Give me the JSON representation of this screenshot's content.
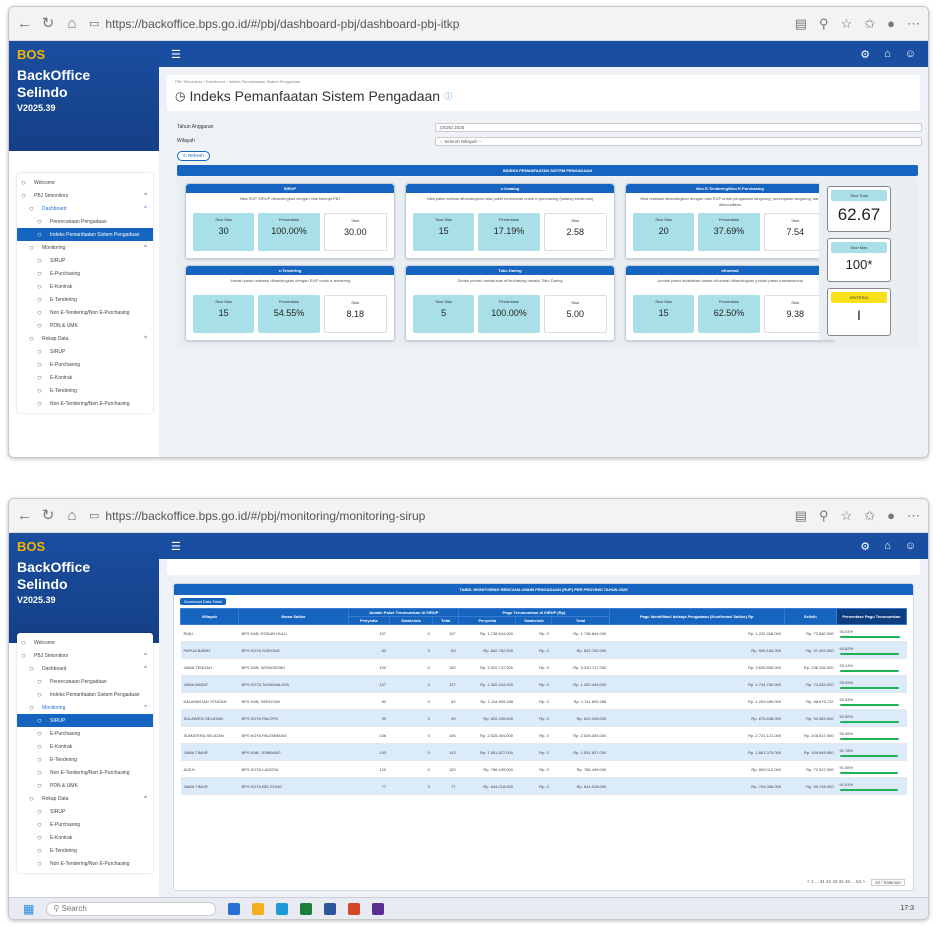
{
  "shot1": {
    "url": "https://backoffice.bps.go.id/#/pbj/dashboard-pbj/dashboard-pbj-itkp",
    "app": {
      "logo": "BOS",
      "name_line1": "BackOffice",
      "name_line2": "Selindo",
      "version": "V2025.39"
    },
    "menu": [
      {
        "label": "Welcome",
        "level": 0
      },
      {
        "label": "PBJ Simonitors",
        "level": 0,
        "caret": "^"
      },
      {
        "label": "Dashboard",
        "level": 1,
        "caret": "^",
        "hi": true
      },
      {
        "label": "Perencanaan Pengadaan",
        "level": 2
      },
      {
        "label": "Indeks Pemanfaatan Sistem Pengadaan",
        "level": 2,
        "selected": true
      },
      {
        "label": "Monitoring",
        "level": 1,
        "caret": "^"
      },
      {
        "label": "SIRUP",
        "level": 2
      },
      {
        "label": "E-Purchasing",
        "level": 2
      },
      {
        "label": "E-Kontrak",
        "level": 2
      },
      {
        "label": "E-Tendering",
        "level": 2
      },
      {
        "label": "Non E-Tendering/Non E-Purchasing",
        "level": 2
      },
      {
        "label": "PDN & UMK",
        "level": 2
      },
      {
        "label": "Rekap Data",
        "level": 1,
        "caret": "^"
      },
      {
        "label": "SIRUP",
        "level": 2
      },
      {
        "label": "E-Purchasing",
        "level": 2
      },
      {
        "label": "E-Kontrak",
        "level": 2
      },
      {
        "label": "E-Tendering",
        "level": 2
      },
      {
        "label": "Non E-Tendering/Non E-Purchasing",
        "level": 2
      }
    ],
    "breadcrumb": "PBJ Simonitors / Dashboard / Indeks Pemanfaatan Sistem Pengadaan",
    "page_title": "Indeks Pemanfaatan Sistem Pengadaan",
    "filter_tahun_label": "Tahun Anggaran",
    "filter_tahun_value": "(2025) 2025",
    "filter_wilayah_label": "Wilayah",
    "filter_wilayah_value": "-- Seluruh Wilayah --",
    "refresh_label": "Refresh",
    "banner": "INDEKS PEMANFAATAN SISTEM PENGADAAN",
    "panels": [
      {
        "title": "SIRUP",
        "desc": "Nilai RUP SIRUP dibandingkan dengan nilai belanja PBJ",
        "k1": "Skor Max",
        "v1": "30",
        "k2": "Persentase",
        "v2": "100.00%",
        "k3": "Skor",
        "v3": "30.00"
      },
      {
        "title": "e-Katalog",
        "desc": "Nilai paket selesai dibandingkan nilai paket berkontrak untuk e-purchasing (katalog elektronik)",
        "k1": "Skor Max",
        "v1": "15",
        "k2": "Persentase",
        "v2": "17.19%",
        "k3": "Skor",
        "v3": "2.58"
      },
      {
        "title": "Non E-Tendering/Non E-Purchasing",
        "desc": "Nilai realisasi dibandingkan dengan nilai RUP untuk pengadaan langsung, penunjukan langsung, dan dikecualikan",
        "k1": "Skor Max",
        "v1": "20",
        "k2": "Persentase",
        "v2": "37.69%",
        "k3": "Skor",
        "v3": "7.54"
      },
      {
        "title": "e-Tendering",
        "desc": "Jumlah paket realisasi dibandingkan dengan RUP untuk e-tendering",
        "k1": "Skor Max",
        "v1": "15",
        "k2": "Persentase",
        "v2": "54.55%",
        "k3": "Skor",
        "v3": "8.18"
      },
      {
        "title": "Toko Daring",
        "desc": "Sudah pernah melakukan ePurchasing melalui Toko Daring",
        "k1": "Skor Max",
        "v1": "5",
        "k2": "Persentase",
        "v2": "100.00%",
        "k3": "Skor",
        "v3": "5.00"
      },
      {
        "title": "eKontrak",
        "desc": "Jumlah paket dicatatkan dalam eKontrak dibandingkan jumlah paket transaksional",
        "k1": "Skor Max",
        "v1": "15",
        "k2": "Persentase",
        "v2": "62.50%",
        "k3": "Skor",
        "v3": "9.38"
      }
    ],
    "skor_total_label": "Skor Total",
    "skor_total_value": "62.67",
    "skor_max_label": "Skor Max",
    "skor_max_value": "100*",
    "kriteria_label": "KRITERIA",
    "kriteria_value": "I"
  },
  "shot2": {
    "url": "https://backoffice.bps.go.id/#/pbj/monitoring/monitoring-sirup",
    "menu": [
      {
        "label": "Welcome",
        "level": 0
      },
      {
        "label": "PBJ Simonitors",
        "level": 0,
        "caret": "^"
      },
      {
        "label": "Dashboard",
        "level": 1,
        "caret": "^"
      },
      {
        "label": "Perencanaan Pengadaan",
        "level": 2
      },
      {
        "label": "Indeks Pemanfaatan Sistem Pengadaan",
        "level": 2
      },
      {
        "label": "Monitoring",
        "level": 1,
        "caret": "^",
        "hi": true
      },
      {
        "label": "SIRUP",
        "level": 2,
        "selected": true
      },
      {
        "label": "E-Purchasing",
        "level": 2
      },
      {
        "label": "E-Kontrak",
        "level": 2
      },
      {
        "label": "E-Tendering",
        "level": 2
      },
      {
        "label": "Non E-Tendering/Non E-Purchasing",
        "level": 2
      },
      {
        "label": "PDN & UMK",
        "level": 2
      },
      {
        "label": "Rekap Data",
        "level": 1,
        "caret": "^"
      },
      {
        "label": "SIRUP",
        "level": 2
      },
      {
        "label": "E-Purchasing",
        "level": 2
      },
      {
        "label": "E-Kontrak",
        "level": 2
      },
      {
        "label": "E-Tendering",
        "level": 2
      },
      {
        "label": "Non E-Tendering/Non E-Purchasing",
        "level": 2
      }
    ],
    "table_title": "TABEL MONITORING RENCANA UMUM PENGADAAN (RUP) PER PROVINSI TAHUN 2025",
    "download_label": "Download Data Tabel",
    "headers": {
      "wilayah": "Wilayah",
      "satker": "Nama Satker",
      "jumlah_group": "Jumlah Paket Terumumkan di SIRUP",
      "pagu_group": "Pagu Terumumkan di SIRUP (Rp)",
      "pagu_id": "Pagu Identifikasi belanja Pengadaan (Konfirmasi Satker) Rp",
      "selisih": "Selisih",
      "pct": "Persentase Pagu Terumumkan",
      "sub": [
        "Penyedia",
        "Swakelola",
        "Total",
        "Penyedia",
        "Swakelola",
        "Total"
      ]
    },
    "rows": [
      [
        "RIAU",
        "BPS KAB. ROKAN HULU",
        "107",
        "0",
        "107",
        "Rp. 1.738.644.000",
        "Rp. 0",
        "Rp. 1.738.644.000",
        "Rp. 1.232.458.000",
        "Rp. 73.580.000",
        "94.04%"
      ],
      [
        "PAPUA BARAT",
        "BPS KOTA SORONG",
        "83",
        "0",
        "83",
        "Rp. 842.782.000",
        "Rp. 0",
        "Rp. 842.782.000",
        "Rp. 900.184.000",
        "Rp. 57.402.000",
        "93.62%"
      ],
      [
        "JAWA TENGAH",
        "BPS KAB. WONOSOBO",
        "100",
        "0",
        "100",
        "Rp. 3.320.747.000",
        "Rp. 0",
        "Rp. 3.320.747.000",
        "Rp. 3.639.855.000",
        "Rp. 236.106.000",
        "93.14%"
      ],
      [
        "JAWA BARAT",
        "BPS KOTA TASIKMALAYA",
        "127",
        "0",
        "127",
        "Rp. 1.320.444.000",
        "Rp. 0",
        "Rp. 1.320.444.000",
        "Rp. 1.744.780.000",
        "Rp. 74.284.000",
        "93.09%"
      ],
      [
        "KALIMANTAN TENGAH",
        "BPS KAB. SERUYAN",
        "82",
        "0",
        "82",
        "Rp. 1.114.809.288",
        "Rp. 0",
        "Rp. 1.114.809.288",
        "Rp. 1.203.489.000",
        "Rp. 88.679.712",
        "92.63%"
      ],
      [
        "SULAWESI SELATAN",
        "BPS KOTA PALOPO",
        "99",
        "0",
        "99",
        "Rp. 620.249.000",
        "Rp. 0",
        "Rp. 620.249.000",
        "Rp. 675.638.000",
        "Rp. 50.389.000",
        "92.50%"
      ],
      [
        "SUMATERA SELATAN",
        "BPS KOTA PALEMBANG",
        "106",
        "0",
        "106",
        "Rp. 2.525.304.000",
        "Rp. 0",
        "Rp. 2.525.304.000",
        "Rp. 2.731.121.000",
        "Rp. 205.817.000",
        "92.46%"
      ],
      [
        "JAWA TIMUR",
        "BPS KAB. JOMBANG",
        "143",
        "0",
        "143",
        "Rp. 1.551.827.000",
        "Rp. 0",
        "Rp. 1.551.827.000",
        "Rp. 1.661.375.000",
        "Rp. 109.548.000",
        "91.78%"
      ],
      [
        "ACEH",
        "BPS KOTA LANGSA",
        "120",
        "0",
        "120",
        "Rp. 786.449.000",
        "Rp. 0",
        "Rp. 786.449.000",
        "Rp. 859.012.000",
        "Rp. 72.927.000",
        "91.56%"
      ],
      [
        "JAWA TIMUR",
        "BPS KOTA BELITUNG",
        "77",
        "0",
        "77",
        "Rp. 644.018.000",
        "Rp. 0",
        "Rp. 644.018.000",
        "Rp. 704.068.000",
        "Rp. 59.748.000",
        "91.51%"
      ]
    ],
    "pct_values": [
      94.04,
      93.62,
      93.14,
      93.09,
      92.63,
      92.5,
      92.46,
      91.78,
      91.56,
      91.51
    ],
    "pagination": "< 1 ... 41 42 43 44 45 ... 54 >",
    "page_size": "10 / halaman",
    "search_label": "Search",
    "time": "17:3"
  }
}
